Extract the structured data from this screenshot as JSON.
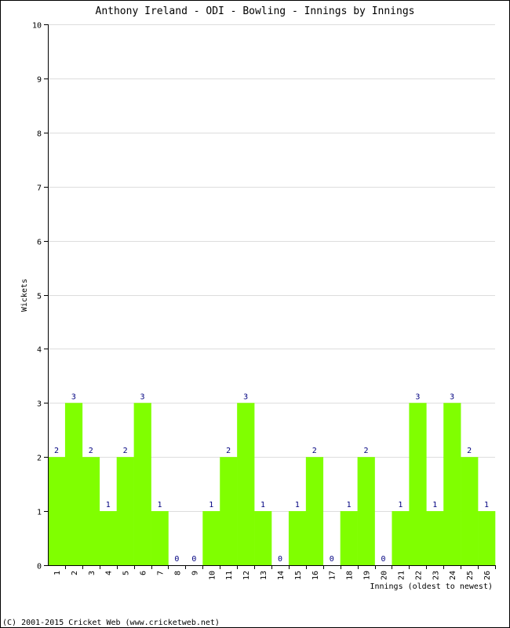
{
  "chart_data": {
    "type": "bar",
    "title": "Anthony Ireland - ODI - Bowling - Innings by Innings",
    "xlabel": "Innings (oldest to newest)",
    "ylabel": "Wickets",
    "ylim": [
      0,
      10
    ],
    "yticks": [
      0,
      1,
      2,
      3,
      4,
      5,
      6,
      7,
      8,
      9,
      10
    ],
    "grid": true,
    "categories": [
      "1",
      "2",
      "3",
      "4",
      "5",
      "6",
      "7",
      "8",
      "9",
      "10",
      "11",
      "12",
      "13",
      "14",
      "15",
      "16",
      "17",
      "18",
      "19",
      "20",
      "21",
      "22",
      "23",
      "24",
      "25",
      "26"
    ],
    "values": [
      2,
      3,
      2,
      1,
      2,
      3,
      1,
      0,
      0,
      1,
      2,
      3,
      1,
      0,
      1,
      2,
      0,
      1,
      2,
      0,
      1,
      3,
      1,
      3,
      2,
      1
    ],
    "bar_color": "#80ff00",
    "label_color": "#000080"
  },
  "footer": "(C) 2001-2015 Cricket Web (www.cricketweb.net)"
}
